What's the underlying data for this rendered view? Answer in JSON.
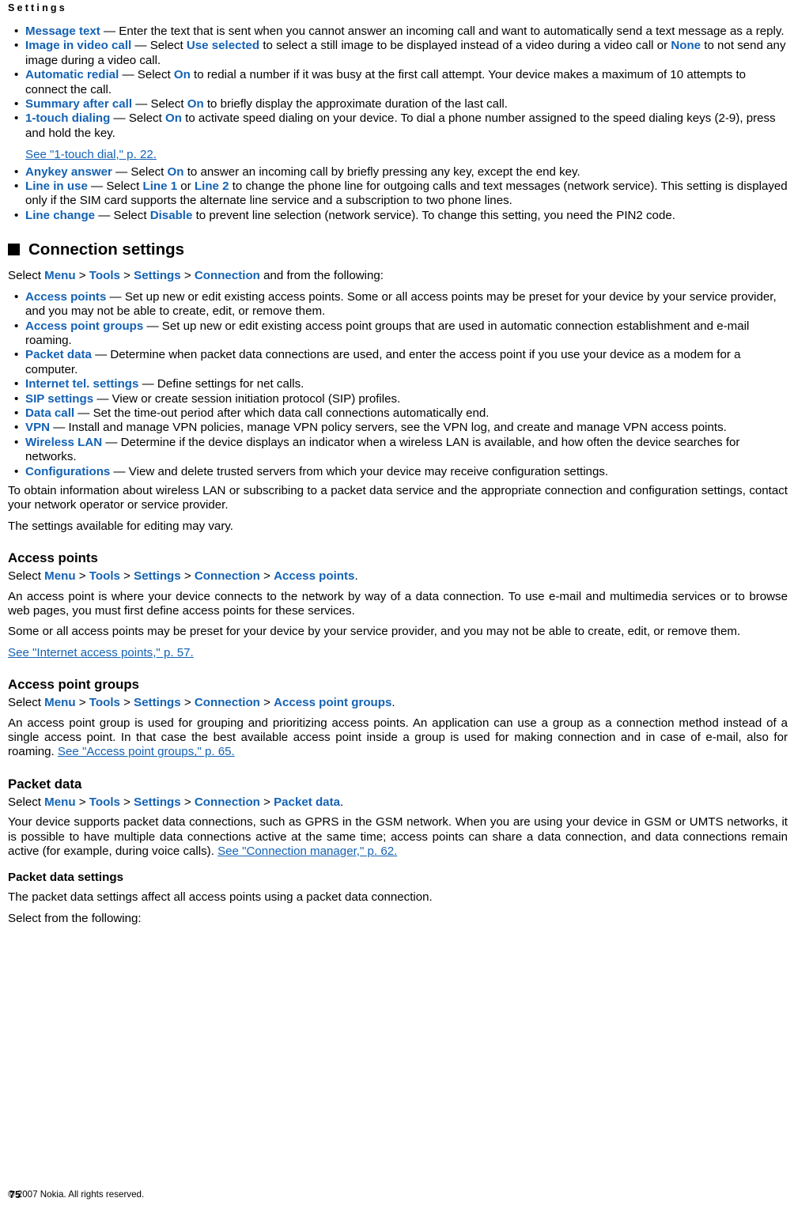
{
  "header": {
    "running_title": "Settings"
  },
  "call_settings_bullets": [
    {
      "term": "Message text",
      "segments": [
        {
          "t": "text",
          "v": " — Enter the text that is sent when you cannot answer an incoming call and want to automatically send a text message as a reply."
        }
      ]
    },
    {
      "term": "Image in video call",
      "segments": [
        {
          "t": "text",
          "v": " — Select "
        },
        {
          "t": "ui",
          "v": "Use selected"
        },
        {
          "t": "text",
          "v": " to select a still image to be displayed instead of a video during a video call or "
        },
        {
          "t": "ui",
          "v": "None"
        },
        {
          "t": "text",
          "v": " to not send any image during a video call."
        }
      ]
    },
    {
      "term": "Automatic redial",
      "segments": [
        {
          "t": "text",
          "v": " — Select "
        },
        {
          "t": "ui",
          "v": "On"
        },
        {
          "t": "text",
          "v": " to redial a number if it was busy at the first call attempt. Your device makes a maximum of 10 attempts to connect the call."
        }
      ]
    },
    {
      "term": "Summary after call",
      "segments": [
        {
          "t": "text",
          "v": " — Select "
        },
        {
          "t": "ui",
          "v": "On"
        },
        {
          "t": "text",
          "v": " to briefly display the approximate duration of the last call."
        }
      ]
    },
    {
      "term": "1-touch dialing",
      "segments": [
        {
          "t": "text",
          "v": " — Select "
        },
        {
          "t": "ui",
          "v": "On"
        },
        {
          "t": "text",
          "v": " to activate speed dialing on your device. To dial a phone number assigned to the speed dialing keys (2-9), press and hold the key."
        },
        {
          "t": "break",
          "v": ""
        },
        {
          "t": "xref",
          "v": "See \"1-touch dial,\" p. 22."
        }
      ]
    },
    {
      "term": "Anykey answer",
      "segments": [
        {
          "t": "text",
          "v": " — Select "
        },
        {
          "t": "ui",
          "v": "On"
        },
        {
          "t": "text",
          "v": " to answer an incoming call by briefly pressing any key, except the end key."
        }
      ]
    },
    {
      "term": "Line in use",
      "segments": [
        {
          "t": "text",
          "v": " — Select "
        },
        {
          "t": "ui",
          "v": "Line 1"
        },
        {
          "t": "text",
          "v": " or "
        },
        {
          "t": "ui",
          "v": "Line 2"
        },
        {
          "t": "text",
          "v": " to change the phone line for outgoing calls and text messages (network service). This setting is displayed only if the SIM card supports the alternate line service and a subscription to two phone lines."
        }
      ]
    },
    {
      "term": "Line change",
      "segments": [
        {
          "t": "text",
          "v": " — Select "
        },
        {
          "t": "ui",
          "v": "Disable"
        },
        {
          "t": "text",
          "v": " to prevent line selection (network service). To change this setting, you need the PIN2 code."
        }
      ]
    }
  ],
  "connection_settings": {
    "heading": "Connection settings",
    "intro_prefix": "Select ",
    "path": [
      "Menu",
      "Tools",
      "Settings",
      "Connection"
    ],
    "intro_suffix": " and from the following:",
    "bullets": [
      {
        "term": "Access points",
        "segments": [
          {
            "t": "text",
            "v": " — Set up new or edit existing access points. Some or all access points may be preset for your device by your service provider, and you may not be able to create, edit, or remove them."
          }
        ]
      },
      {
        "term": "Access point groups",
        "segments": [
          {
            "t": "text",
            "v": " — Set up new or edit existing access point groups that are used in automatic connection establishment and e-mail roaming."
          }
        ]
      },
      {
        "term": "Packet data",
        "segments": [
          {
            "t": "text",
            "v": " — Determine when packet data connections are used, and enter the access point if you use your device as a modem for a computer."
          }
        ]
      },
      {
        "term": "Internet tel. settings",
        "segments": [
          {
            "t": "text",
            "v": " — Define settings for net calls."
          }
        ]
      },
      {
        "term": "SIP settings",
        "segments": [
          {
            "t": "text",
            "v": " — View or create session initiation protocol (SIP) profiles."
          }
        ]
      },
      {
        "term": "Data call",
        "segments": [
          {
            "t": "text",
            "v": " — Set the time-out period after which data call connections automatically end."
          }
        ]
      },
      {
        "term": "VPN",
        "segments": [
          {
            "t": "text",
            "v": " — Install and manage VPN policies, manage VPN policy servers, see the VPN log, and create and manage VPN access points."
          }
        ]
      },
      {
        "term": "Wireless LAN",
        "segments": [
          {
            "t": "text",
            "v": " — Determine if the device displays an indicator when a wireless LAN is available, and how often the device searches for networks."
          }
        ]
      },
      {
        "term": "Configurations",
        "segments": [
          {
            "t": "text",
            "v": " — View and delete trusted servers from which your device may receive configuration settings."
          }
        ]
      }
    ],
    "note1": "To obtain information about wireless LAN or subscribing to a packet data service and the appropriate connection and configuration settings, contact your network operator or service provider.",
    "note2": "The settings available for editing may vary."
  },
  "access_points": {
    "heading": "Access points",
    "select_prefix": "Select ",
    "path": [
      "Menu",
      "Tools",
      "Settings",
      "Connection",
      "Access points"
    ],
    "select_suffix": ".",
    "para1": "An access point is where your device connects to the network by way of a data connection. To use e-mail and multimedia services or to browse web pages, you must first define access points for these services.",
    "para2": "Some or all access points may be preset for your device by your service provider, and you may not be able to create, edit, or remove them.",
    "xref": "See \"Internet access points,\" p. 57."
  },
  "access_point_groups": {
    "heading": "Access point groups",
    "select_prefix": "Select ",
    "path": [
      "Menu",
      "Tools",
      "Settings",
      "Connection",
      "Access point groups"
    ],
    "select_suffix": ".",
    "para1": "An access point group is used for grouping and prioritizing access points. An application can use a group as a connection method instead of a single access point. In that case the best available access point inside a group is used for making connection and in case of e-mail, also for roaming. ",
    "xref": "See \"Access point groups,\" p. 65."
  },
  "packet_data": {
    "heading": "Packet data",
    "select_prefix": "Select ",
    "path": [
      "Menu",
      "Tools",
      "Settings",
      "Connection",
      "Packet data"
    ],
    "select_suffix": ".",
    "para1": "Your device supports packet data connections, such as GPRS in the GSM network. When you are using your device in GSM or UMTS networks, it is possible to have multiple data connections active at the same time; access points can share a data connection, and data connections remain active (for example, during voice calls). ",
    "xref": "See \"Connection manager,\" p. 62.",
    "sub_heading": "Packet data settings",
    "para2": "The packet data settings affect all access points using a packet data connection.",
    "para3": "Select from the following:"
  },
  "footer": {
    "copyright": "© 2007 Nokia. All rights reserved.",
    "page_number": "75"
  },
  "colors": {
    "link_blue": "#1462B4",
    "text_black": "#000000",
    "page_background": "#ffffff"
  }
}
